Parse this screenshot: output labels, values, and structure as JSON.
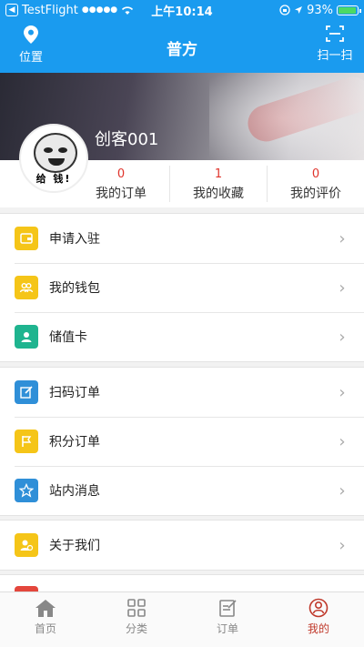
{
  "status_bar": {
    "carrier": "TestFlight",
    "signal": "●●●●●",
    "time": "上午10:14",
    "battery": "93%",
    "battery_level": 0.93
  },
  "nav": {
    "title": "普方",
    "left_label": "位置",
    "right_label": "扫一扫"
  },
  "profile": {
    "username": "创客001",
    "avatar_caption": "给 钱!"
  },
  "stats": [
    {
      "count": "0",
      "label": "我的订单"
    },
    {
      "count": "1",
      "label": "我的收藏"
    },
    {
      "count": "0",
      "label": "我的评价"
    }
  ],
  "menu_groups": [
    [
      {
        "label": "申请入驻",
        "icon": "wallet-icon",
        "color": "#f5c518"
      },
      {
        "label": "我的钱包",
        "icon": "people-icon",
        "color": "#f5c518"
      },
      {
        "label": "储值卡",
        "icon": "card-user-icon",
        "color": "#1fb48f"
      }
    ],
    [
      {
        "label": "扫码订单",
        "icon": "edit-icon",
        "color": "#2f8fd8"
      },
      {
        "label": "积分订单",
        "icon": "flag-icon",
        "color": "#f5c518"
      },
      {
        "label": "站内消息",
        "icon": "star-icon",
        "color": "#2f8fd8"
      }
    ],
    [
      {
        "label": "关于我们",
        "icon": "about-icon",
        "color": "#f5c518"
      }
    ]
  ],
  "tabs": [
    {
      "label": "首页",
      "icon": "home-icon",
      "active": false
    },
    {
      "label": "分类",
      "icon": "grid-icon",
      "active": false
    },
    {
      "label": "订单",
      "icon": "order-icon",
      "active": false
    },
    {
      "label": "我的",
      "icon": "user-icon",
      "active": true
    }
  ],
  "colors": {
    "primary": "#1a9bef",
    "accent_red": "#e0342c",
    "tab_active": "#c0392b"
  }
}
